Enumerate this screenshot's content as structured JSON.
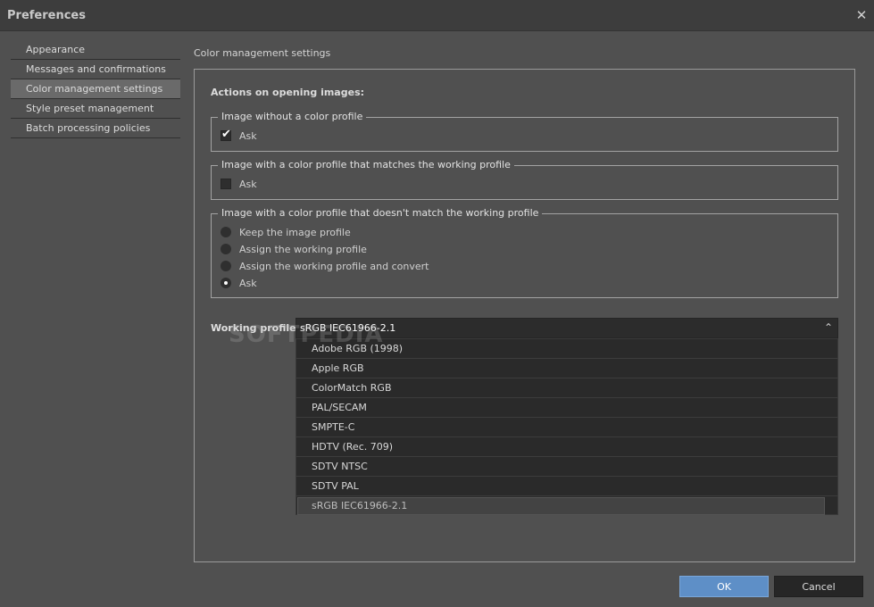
{
  "window": {
    "title": "Preferences",
    "close_glyph": "✕"
  },
  "sidebar": {
    "items": [
      {
        "label": "Appearance",
        "selected": false
      },
      {
        "label": "Messages and confirmations",
        "selected": false
      },
      {
        "label": "Color management settings",
        "selected": true
      },
      {
        "label": "Style preset management",
        "selected": false
      },
      {
        "label": "Batch processing policies",
        "selected": false
      }
    ]
  },
  "content": {
    "section_title": "Color management settings",
    "actions_label": "Actions on opening images:",
    "group_no_profile": {
      "legend": "Image without a color profile",
      "ask_label": "Ask",
      "ask_checked": true
    },
    "group_matching_profile": {
      "legend": "Image with a color profile that matches the working profile",
      "ask_label": "Ask",
      "ask_checked": false
    },
    "group_mismatch_profile": {
      "legend": "Image with a color profile that doesn't match the working profile",
      "options": [
        {
          "label": "Keep the image profile",
          "selected": false
        },
        {
          "label": "Assign the working profile",
          "selected": false
        },
        {
          "label": "Assign the working profile and convert",
          "selected": false
        },
        {
          "label": "Ask",
          "selected": true
        }
      ]
    },
    "working_profile": {
      "label": "Working profile:",
      "value": "sRGB IEC61966-2.1",
      "arrow_glyph": "⌃",
      "options": [
        "Adobe RGB (1998)",
        "Apple RGB",
        "ColorMatch RGB",
        "PAL/SECAM",
        "SMPTE-C",
        "HDTV (Rec. 709)",
        "SDTV NTSC",
        "SDTV PAL",
        "sRGB IEC61966-2.1"
      ]
    },
    "watermark": "SOFTPEDIA"
  },
  "buttons": {
    "ok": "OK",
    "cancel": "Cancel"
  },
  "colors": {
    "background": "#505050",
    "titlebar": "#3d3d3d",
    "accent": "#5e8fc7"
  }
}
